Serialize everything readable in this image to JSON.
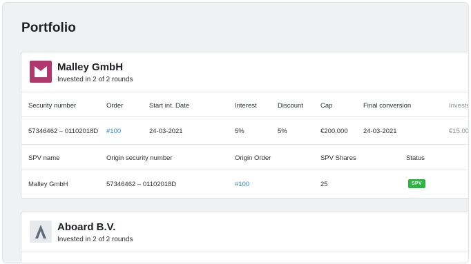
{
  "page": {
    "title": "Portfolio"
  },
  "companies": [
    {
      "name": "Malley GmbH",
      "subtitle": "Invested in 2 of 2 rounds",
      "logo_color": "#b1386c",
      "security_headers": [
        "Security number",
        "Order",
        "Start int. Date",
        "Interest",
        "Discount",
        "Cap",
        "Final conversion",
        "Investe"
      ],
      "security_row": [
        "57346462 – 01102018D",
        "#100",
        "24-03-2021",
        "5%",
        "5%",
        "€200.000",
        "24-03-2021",
        "€15.00"
      ],
      "spv_headers": [
        "SPV name",
        "Origin security number",
        "Origin Order",
        "SPV Shares",
        "Status"
      ],
      "spv_row": [
        "Malley GmbH",
        "57346462 – 01102018D",
        "#100",
        "25"
      ],
      "status_badge": "SPV",
      "status_color": "#2db543"
    },
    {
      "name": "Aboard B.V.",
      "subtitle": "Invested in 2 of 2 rounds",
      "logo_color": "#e7e9ec"
    }
  ]
}
